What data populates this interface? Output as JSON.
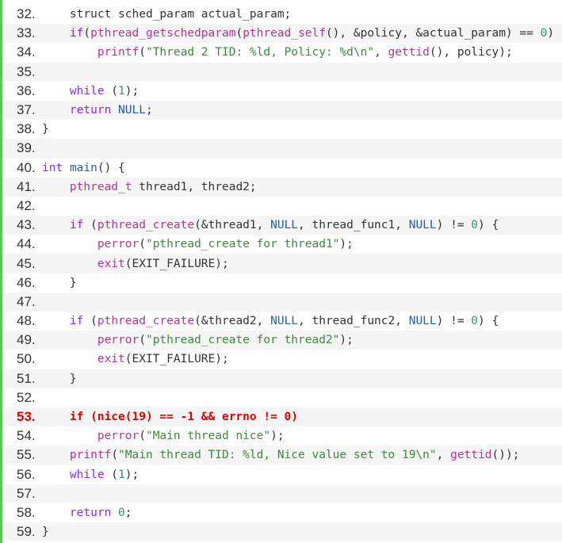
{
  "lines": [
    {
      "n": "32.",
      "tokens": [
        [
          "p",
          "    "
        ],
        [
          "p",
          "struct sched_param actual_param;"
        ]
      ]
    },
    {
      "n": "33.",
      "tokens": [
        [
          "p",
          "    "
        ],
        [
          "kw",
          "if"
        ],
        [
          "p",
          "("
        ],
        [
          "fn",
          "pthread_getschedparam"
        ],
        [
          "p",
          "("
        ],
        [
          "fn",
          "pthread_self"
        ],
        [
          "p",
          "(), &policy, &actual_param) == "
        ],
        [
          "num",
          "0"
        ],
        [
          "p",
          ")"
        ]
      ]
    },
    {
      "n": "34.",
      "tokens": [
        [
          "p",
          "        "
        ],
        [
          "fn",
          "printf"
        ],
        [
          "p",
          "("
        ],
        [
          "str",
          "\"Thread 2 TID: %ld, Policy: %d\\n\""
        ],
        [
          "p",
          ", "
        ],
        [
          "fn",
          "gettid"
        ],
        [
          "p",
          "(), policy);"
        ]
      ]
    },
    {
      "n": "35.",
      "tokens": []
    },
    {
      "n": "36.",
      "tokens": [
        [
          "p",
          "    "
        ],
        [
          "kw",
          "while"
        ],
        [
          "p",
          " ("
        ],
        [
          "num",
          "1"
        ],
        [
          "p",
          ");"
        ]
      ]
    },
    {
      "n": "37.",
      "tokens": [
        [
          "p",
          "    "
        ],
        [
          "kw",
          "return"
        ],
        [
          "p",
          " "
        ],
        [
          "cst",
          "NULL"
        ],
        [
          "p",
          ";"
        ]
      ]
    },
    {
      "n": "38.",
      "tokens": [
        [
          "p",
          "}"
        ]
      ]
    },
    {
      "n": "39.",
      "tokens": []
    },
    {
      "n": "40.",
      "tokens": [
        [
          "typ",
          "int"
        ],
        [
          "p",
          " "
        ],
        [
          "cst",
          "main"
        ],
        [
          "p",
          "() {"
        ]
      ]
    },
    {
      "n": "41.",
      "tokens": [
        [
          "p",
          "    "
        ],
        [
          "fn",
          "pthread_t"
        ],
        [
          "p",
          " thread1, thread2;"
        ]
      ]
    },
    {
      "n": "42.",
      "tokens": []
    },
    {
      "n": "43.",
      "tokens": [
        [
          "p",
          "    "
        ],
        [
          "kw",
          "if"
        ],
        [
          "p",
          " ("
        ],
        [
          "fn",
          "pthread_create"
        ],
        [
          "p",
          "(&thread1, "
        ],
        [
          "cst",
          "NULL"
        ],
        [
          "p",
          ", thread_func1, "
        ],
        [
          "cst",
          "NULL"
        ],
        [
          "p",
          ") != "
        ],
        [
          "num",
          "0"
        ],
        [
          "p",
          ") {"
        ]
      ]
    },
    {
      "n": "44.",
      "tokens": [
        [
          "p",
          "        "
        ],
        [
          "fn",
          "perror"
        ],
        [
          "p",
          "("
        ],
        [
          "str",
          "\"pthread_create for thread1\""
        ],
        [
          "p",
          ");"
        ]
      ]
    },
    {
      "n": "45.",
      "tokens": [
        [
          "p",
          "        "
        ],
        [
          "fn",
          "exit"
        ],
        [
          "p",
          "(EXIT_FAILURE);"
        ]
      ]
    },
    {
      "n": "46.",
      "tokens": [
        [
          "p",
          "    }"
        ]
      ]
    },
    {
      "n": "47.",
      "tokens": []
    },
    {
      "n": "48.",
      "tokens": [
        [
          "p",
          "    "
        ],
        [
          "kw",
          "if"
        ],
        [
          "p",
          " ("
        ],
        [
          "fn",
          "pthread_create"
        ],
        [
          "p",
          "(&thread2, "
        ],
        [
          "cst",
          "NULL"
        ],
        [
          "p",
          ", thread_func2, "
        ],
        [
          "cst",
          "NULL"
        ],
        [
          "p",
          ") != "
        ],
        [
          "num",
          "0"
        ],
        [
          "p",
          ") {"
        ]
      ]
    },
    {
      "n": "49.",
      "tokens": [
        [
          "p",
          "        "
        ],
        [
          "fn",
          "perror"
        ],
        [
          "p",
          "("
        ],
        [
          "str",
          "\"pthread_create for thread2\""
        ],
        [
          "p",
          ");"
        ]
      ]
    },
    {
      "n": "50.",
      "tokens": [
        [
          "p",
          "        "
        ],
        [
          "fn",
          "exit"
        ],
        [
          "p",
          "(EXIT_FAILURE);"
        ]
      ]
    },
    {
      "n": "51.",
      "tokens": [
        [
          "p",
          "    }"
        ]
      ]
    },
    {
      "n": "52.",
      "tokens": []
    },
    {
      "n": "53.",
      "highlight": true,
      "tokens": [
        [
          "p",
          "    if (nice(19) == -1 && errno != 0)"
        ]
      ]
    },
    {
      "n": "54.",
      "tokens": [
        [
          "p",
          "        "
        ],
        [
          "fn",
          "perror"
        ],
        [
          "p",
          "("
        ],
        [
          "str",
          "\"Main thread nice\""
        ],
        [
          "p",
          ");"
        ]
      ]
    },
    {
      "n": "55.",
      "tokens": [
        [
          "p",
          "    "
        ],
        [
          "fn",
          "printf"
        ],
        [
          "p",
          "("
        ],
        [
          "str",
          "\"Main thread TID: %ld, Nice value set to 19\\n\""
        ],
        [
          "p",
          ", "
        ],
        [
          "fn",
          "gettid"
        ],
        [
          "p",
          "());"
        ]
      ]
    },
    {
      "n": "56.",
      "tokens": [
        [
          "p",
          "    "
        ],
        [
          "kw",
          "while"
        ],
        [
          "p",
          " ("
        ],
        [
          "num",
          "1"
        ],
        [
          "p",
          ");"
        ]
      ]
    },
    {
      "n": "57.",
      "tokens": []
    },
    {
      "n": "58.",
      "tokens": [
        [
          "p",
          "    "
        ],
        [
          "kw",
          "return"
        ],
        [
          "p",
          " "
        ],
        [
          "num",
          "0"
        ],
        [
          "p",
          ";"
        ]
      ]
    },
    {
      "n": "59.",
      "tokens": [
        [
          "p",
          "}"
        ]
      ]
    }
  ],
  "colors": {
    "gutter_bar": "#5cc85c",
    "highlight": "#e00000",
    "keyword": "#8a2be2",
    "function": "#b5358f",
    "constant": "#1f5fa8",
    "string": "#3a8a3a",
    "number": "#2c9a6e"
  }
}
